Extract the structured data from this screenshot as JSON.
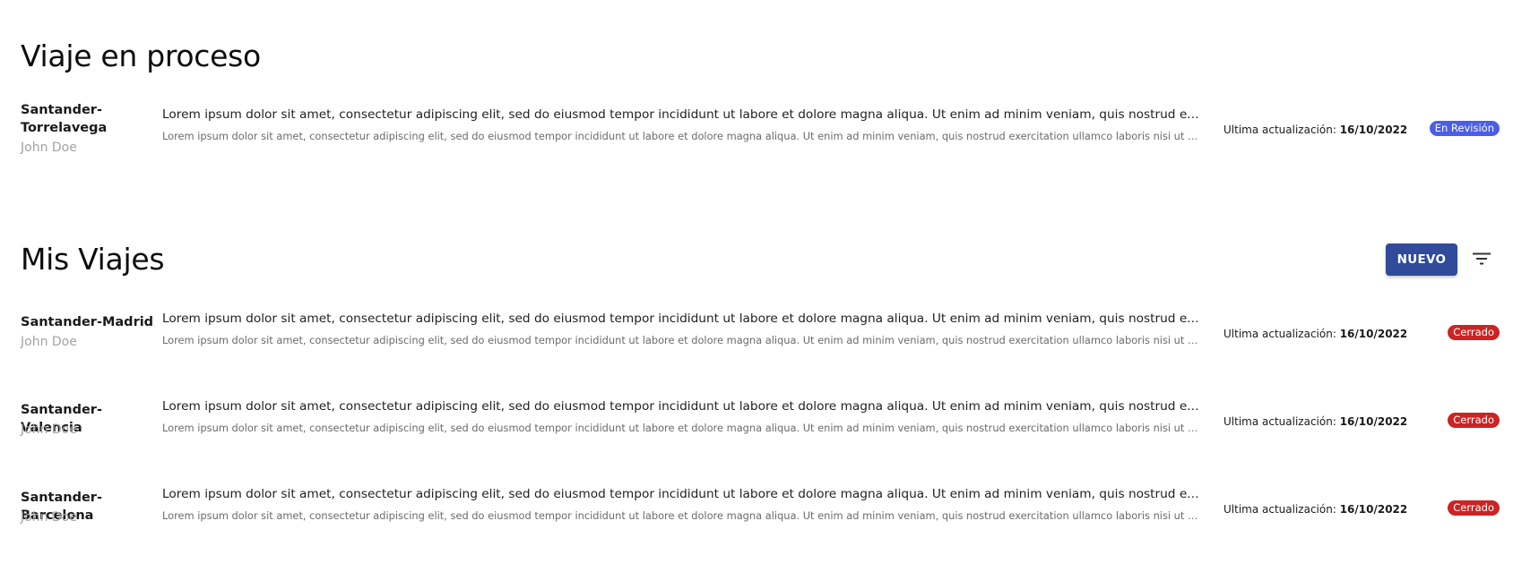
{
  "current_section": {
    "title": "Viaje en proceso",
    "trip": {
      "route": "Santander-Torrelavega",
      "user": "John Doe",
      "description": "Lorem ipsum dolor sit amet, consectetur adipiscing elit, sed do eiusmod tempor incididunt ut labore et dolore magna aliqua. Ut enim ad minim veniam, quis nostrud exercitation ullamco laboris",
      "description_sub": "Lorem ipsum dolor sit amet, consectetur adipiscing elit, sed do eiusmod tempor incididunt ut labore et dolore magna aliqua. Ut enim ad minim veniam, quis nostrud exercitation ullamco laboris nisi ut aliquip ex ea commodo",
      "update_label": "Ultima actualización: ",
      "update_date": "16/10/2022",
      "status": "En Revisión",
      "status_color": "#4a5ee8"
    }
  },
  "my_trips": {
    "title": "Mis Viajes",
    "new_button_label": "NUEVO",
    "filter_icon": "filter-icon",
    "trips": [
      {
        "route": "Santander-Madrid",
        "user": "John Doe",
        "description": "Lorem ipsum dolor sit amet, consectetur adipiscing elit, sed do eiusmod tempor incididunt ut labore et dolore magna aliqua. Ut enim ad minim veniam, quis nostrud exercitation ullamco laboris",
        "description_sub": "Lorem ipsum dolor sit amet, consectetur adipiscing elit, sed do eiusmod tempor incididunt ut labore et dolore magna aliqua. Ut enim ad minim veniam, quis nostrud exercitation ullamco laboris nisi ut aliquip ex ea commodo",
        "update_label": "Ultima actualización: ",
        "update_date": "16/10/2022",
        "status": "Cerrado",
        "status_color": "#cc2424"
      },
      {
        "route": "Santander-Valencia",
        "user": "John Doe",
        "description": "Lorem ipsum dolor sit amet, consectetur adipiscing elit, sed do eiusmod tempor incididunt ut labore et dolore magna aliqua. Ut enim ad minim veniam, quis nostrud exercitation ullamco laboris",
        "description_sub": "Lorem ipsum dolor sit amet, consectetur adipiscing elit, sed do eiusmod tempor incididunt ut labore et dolore magna aliqua. Ut enim ad minim veniam, quis nostrud exercitation ullamco laboris nisi ut aliquip ex ea commodo",
        "update_label": "Ultima actualización: ",
        "update_date": "16/10/2022",
        "status": "Cerrado",
        "status_color": "#cc2424"
      },
      {
        "route": "Santander-Barcelona",
        "user": "John Doe",
        "description": "Lorem ipsum dolor sit amet, consectetur adipiscing elit, sed do eiusmod tempor incididunt ut labore et dolore magna aliqua. Ut enim ad minim veniam, quis nostrud exercitation ullamco laboris",
        "description_sub": "Lorem ipsum dolor sit amet, consectetur adipiscing elit, sed do eiusmod tempor incididunt ut labore et dolore magna aliqua. Ut enim ad minim veniam, quis nostrud exercitation ullamco laboris nisi ut aliquip ex ea commodo",
        "update_label": "Ultima actualización: ",
        "update_date": "16/10/2022",
        "status": "Cerrado",
        "status_color": "#cc2424"
      }
    ]
  }
}
